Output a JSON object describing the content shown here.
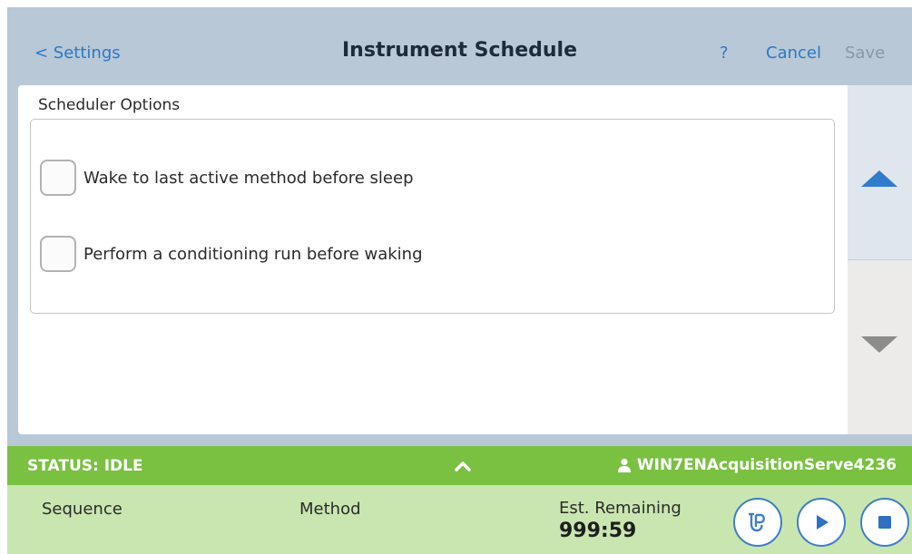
{
  "header": {
    "back_label": "< Settings",
    "title": "Instrument Schedule",
    "help_label": "?",
    "cancel_label": "Cancel",
    "save_label": "Save"
  },
  "content": {
    "section_label": "Scheduler Options",
    "options": [
      {
        "label": "Wake to last active method before sleep",
        "checked": false
      },
      {
        "label": "Perform a conditioning run before waking",
        "checked": false
      }
    ]
  },
  "scroller": {
    "up_icon": "triangle-up-icon",
    "down_icon": "triangle-down-icon"
  },
  "status_bar": {
    "status_text": "STATUS: IDLE",
    "expand_icon": "chevron-up-icon",
    "user_icon": "user-icon",
    "user_name": "WIN7ENAcquisitionServe4236"
  },
  "bottom_panel": {
    "sequence_label": "Sequence",
    "method_label": "Method",
    "remaining_label": "Est. Remaining",
    "remaining_value": "999:59",
    "buttons": [
      "vial-icon",
      "play-icon",
      "stop-icon"
    ]
  },
  "colors": {
    "accent_blue": "#2979c8",
    "status_green": "#7ac142",
    "panel_green": "#c9e6b0",
    "header_bg": "#b8c8d6"
  }
}
